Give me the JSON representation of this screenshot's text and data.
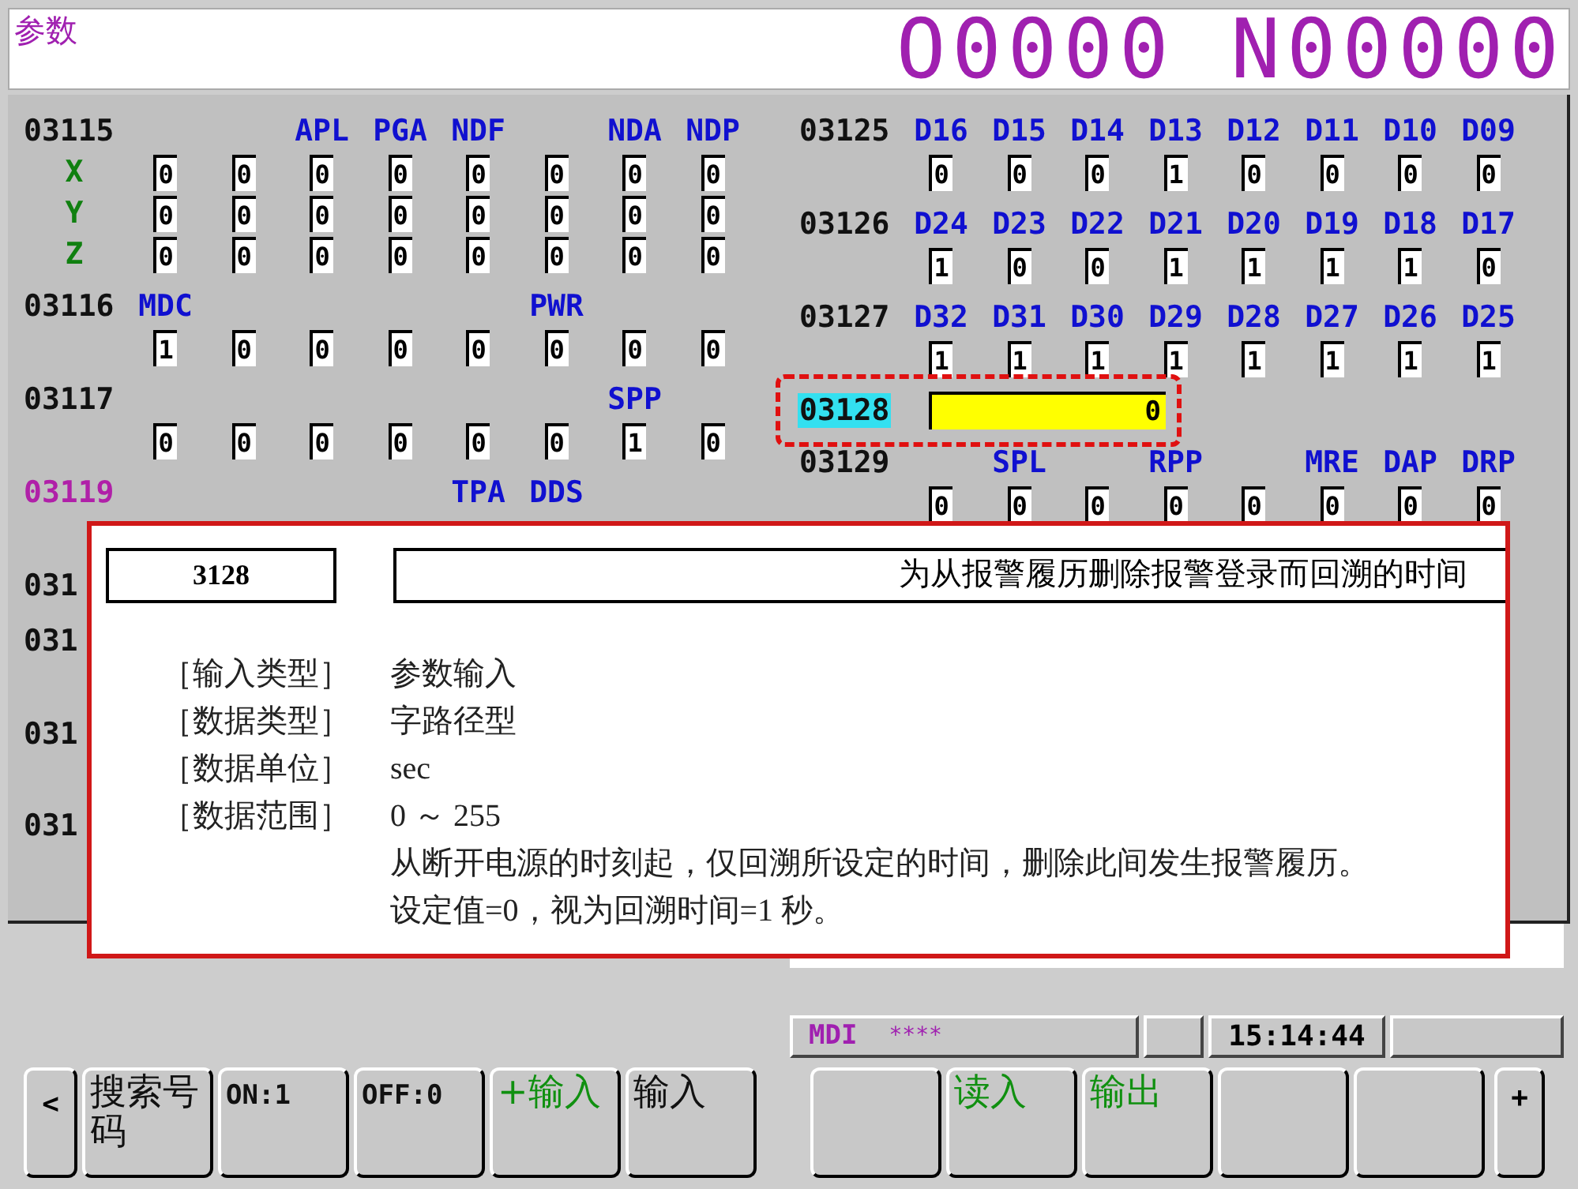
{
  "header": {
    "title": "参数",
    "program": "O0000 N00000"
  },
  "left_params": [
    {
      "number": "03115",
      "kind": "bit",
      "selected": false,
      "highlighted": false,
      "names": {
        "bit5": "APL",
        "bit4": "PGA",
        "bit3": "NDF",
        "bit1": "NDA",
        "bit0": "NDP"
      },
      "rows": [
        {
          "axis": "X",
          "bits": [
            "0",
            "0",
            "0",
            "0",
            "0",
            "0",
            "0",
            "0"
          ]
        },
        {
          "axis": "Y",
          "bits": [
            "0",
            "0",
            "0",
            "0",
            "0",
            "0",
            "0",
            "0"
          ]
        },
        {
          "axis": "Z",
          "bits": [
            "0",
            "0",
            "0",
            "0",
            "0",
            "0",
            "0",
            "0"
          ]
        }
      ]
    },
    {
      "number": "03116",
      "kind": "bit",
      "selected": false,
      "highlighted": false,
      "names": {
        "bit7": "MDC",
        "bit2": "PWR"
      },
      "rows": [
        {
          "bits": [
            "1",
            "0",
            "0",
            "0",
            "0",
            "0",
            "0",
            "0"
          ]
        }
      ]
    },
    {
      "number": "03117",
      "kind": "bit",
      "selected": false,
      "highlighted": false,
      "names": {
        "bit1": "SPP"
      },
      "rows": [
        {
          "bits": [
            "0",
            "0",
            "0",
            "0",
            "0",
            "0",
            "1",
            "0"
          ]
        }
      ]
    },
    {
      "number": "03119",
      "kind": "bit",
      "selected": false,
      "highlighted": true,
      "names": {
        "bit3": "TPA",
        "bit2": "DDS"
      }
    },
    {
      "number": "031",
      "kind": "label",
      "selected": false,
      "highlighted": false
    },
    {
      "number": "031",
      "kind": "label",
      "selected": false,
      "highlighted": false
    },
    {
      "number": "031",
      "kind": "label",
      "selected": false,
      "highlighted": false
    },
    {
      "number": "031",
      "kind": "label",
      "selected": false,
      "highlighted": false
    }
  ],
  "right_params": [
    {
      "number": "03125",
      "kind": "bit",
      "selected": false,
      "highlighted": false,
      "names": {
        "bit7": "D16",
        "bit6": "D15",
        "bit5": "D14",
        "bit4": "D13",
        "bit3": "D12",
        "bit2": "D11",
        "bit1": "D10",
        "bit0": "D09"
      },
      "rows": [
        {
          "bits": [
            "0",
            "0",
            "0",
            "1",
            "0",
            "0",
            "0",
            "0"
          ]
        }
      ]
    },
    {
      "number": "03126",
      "kind": "bit",
      "selected": false,
      "highlighted": false,
      "names": {
        "bit7": "D24",
        "bit6": "D23",
        "bit5": "D22",
        "bit4": "D21",
        "bit3": "D20",
        "bit2": "D19",
        "bit1": "D18",
        "bit0": "D17"
      },
      "rows": [
        {
          "bits": [
            "1",
            "0",
            "0",
            "1",
            "1",
            "1",
            "1",
            "0"
          ]
        }
      ]
    },
    {
      "number": "03127",
      "kind": "bit",
      "selected": false,
      "highlighted": false,
      "names": {
        "bit7": "D32",
        "bit6": "D31",
        "bit5": "D30",
        "bit4": "D29",
        "bit3": "D28",
        "bit2": "D27",
        "bit1": "D26",
        "bit0": "D25"
      },
      "rows": [
        {
          "bits": [
            "1",
            "1",
            "1",
            "1",
            "1",
            "1",
            "1",
            "1"
          ]
        }
      ]
    },
    {
      "number": "03128",
      "kind": "value",
      "selected": true,
      "highlighted": false,
      "annotated": true,
      "value": "0"
    },
    {
      "number": "03129",
      "kind": "bit",
      "selected": false,
      "highlighted": false,
      "names": {
        "bit6": "SPL",
        "bit4": "RPP",
        "bit2": "MRE",
        "bit1": "DAP",
        "bit0": "DRP"
      },
      "rows": [
        {
          "bits": [
            "0",
            "0",
            "0",
            "0",
            "0",
            "0",
            "0",
            "0"
          ]
        }
      ]
    }
  ],
  "popup": {
    "number": "3128",
    "title": "为从报警履历删除报警登录而回溯的时间",
    "fields": [
      {
        "label": "［输入类型］",
        "value": "参数输入"
      },
      {
        "label": "［数据类型］",
        "value": "字路径型"
      },
      {
        "label": "［数据单位］",
        "value": "sec"
      },
      {
        "label": "［数据范围］",
        "value": "0 ～ 255"
      }
    ],
    "notes": [
      "从断开电源的时刻起，仅回溯所设定的时间，删除此间发生报警履历。",
      "设定值=0，视为回溯时间=1 秒。"
    ]
  },
  "status": {
    "mode": "MDI",
    "indicator": "****",
    "time": "15:14:44"
  },
  "softkeys": {
    "prev": "<",
    "next": "+",
    "left": [
      {
        "label": "搜索号码",
        "kind": "plain"
      },
      {
        "label": "ON:1",
        "kind": "mono"
      },
      {
        "label": "OFF:0",
        "kind": "mono"
      },
      {
        "label": "+输入",
        "kind": "command"
      },
      {
        "label": "输入",
        "kind": "plain"
      }
    ],
    "right": [
      {
        "kind": "plain"
      },
      {
        "label": "读入",
        "kind": "command"
      },
      {
        "label": "输出",
        "kind": "command"
      },
      {
        "kind": "plain"
      },
      {
        "kind": "plain"
      }
    ]
  }
}
